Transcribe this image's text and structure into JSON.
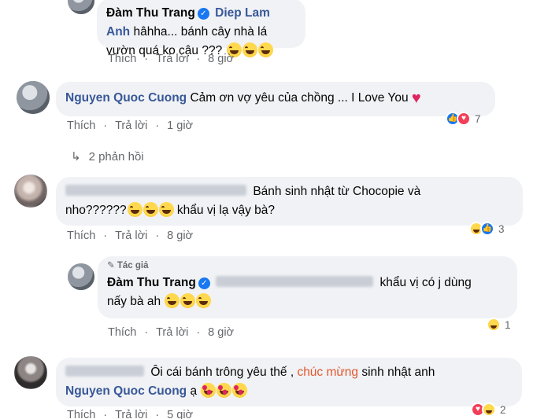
{
  "comments": [
    {
      "name": "Đàm Thu Trang",
      "mention": "Diep Lam Anh",
      "text_line1": "hâhha... bánh cây nhà lá",
      "text_line2": "vườn quá ko cậu ???",
      "emoji_count": 3,
      "actions": {
        "like": "Thích",
        "reply": "Trả lời",
        "time": "8 giờ"
      }
    },
    {
      "name": "Nguyen Quoc Cuong",
      "text": "Cảm ơn vợ yêu của chồng ... I Love You",
      "heart": "♥",
      "actions": {
        "like": "Thích",
        "reply": "Trả lời",
        "time": "1 giờ"
      },
      "reactions": {
        "icons": [
          "like",
          "love"
        ],
        "count": "7"
      }
    },
    {
      "replies_link": "2 phản hồi"
    },
    {
      "text_line1": "Bánh sinh nhật từ Chocopie và",
      "text_line2a": "nho??????",
      "text_line2b": "khẩu vị lạ vậy bà?",
      "actions": {
        "like": "Thích",
        "reply": "Trả lời",
        "time": "8 giờ"
      },
      "reactions": {
        "icons": [
          "haha",
          "like"
        ],
        "count": "3"
      }
    },
    {
      "author_label": "Tác giả",
      "name": "Đàm Thu Trang",
      "text_line1": "khẩu vị có j dùng",
      "text_line2": "nấy bà ah",
      "actions": {
        "like": "Thích",
        "reply": "Trả lời",
        "time": "8 giờ"
      },
      "reactions": {
        "icons": [
          "haha"
        ],
        "count": "1"
      }
    },
    {
      "text_part1": "Ôi cái bánh trông yêu thế ,",
      "highlight": "chúc mừng",
      "text_part2": "sinh nhật anh",
      "mention": "Nguyen Quoc Cuong",
      "text_part3": "ạ",
      "actions": {
        "like": "Thích",
        "reply": "Trả lời",
        "time": "5 giờ"
      },
      "reactions": {
        "icons": [
          "love",
          "haha"
        ],
        "count": "2"
      }
    }
  ],
  "colors": {
    "name": "#385898",
    "bubble": "#f0f2f5",
    "meta": "#65676b",
    "like": "#1877f2",
    "love": "#f33e58",
    "highlight": "#e4572e"
  }
}
